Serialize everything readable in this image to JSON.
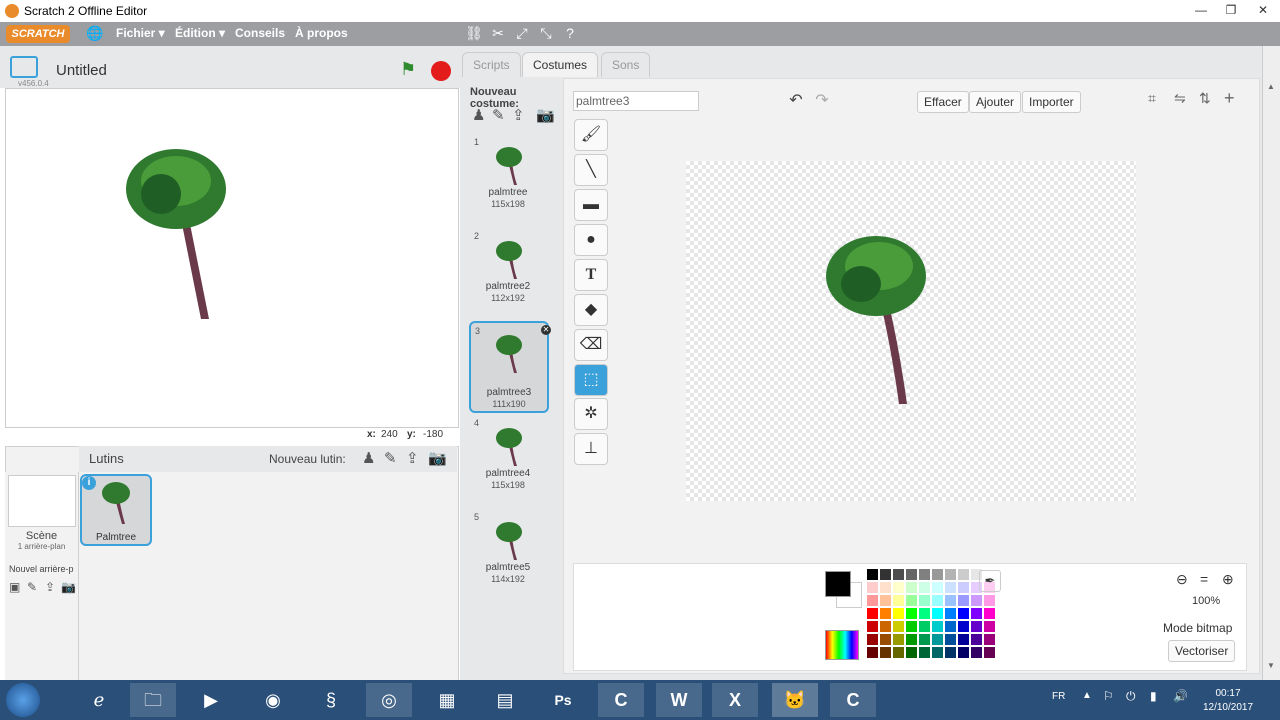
{
  "window": {
    "title": "Scratch 2 Offline Editor",
    "minimize": "—",
    "maximize": "❐",
    "close": "✕"
  },
  "menubar": {
    "logo": "SCRATCH",
    "items": [
      "Fichier ▾",
      "Édition ▾",
      "Conseils",
      "À propos"
    ]
  },
  "stage": {
    "project_title": "Untitled",
    "version": "v456.0.4",
    "x_label": "x:",
    "x_value": "240",
    "y_label": "y:",
    "y_value": "-180"
  },
  "sprites": {
    "header": "Lutins",
    "new_sprite_label": "Nouveau lutin:",
    "scene_label": "Scène",
    "scene_sub": "1 arrière-plan",
    "new_backdrop_label": "Nouvel arrière-p",
    "items": [
      {
        "name": "Palmtree",
        "selected": true
      }
    ]
  },
  "tabs": [
    "Scripts",
    "Costumes",
    "Sons"
  ],
  "active_tab": "Costumes",
  "costumes": {
    "new_label": "Nouveau costume:",
    "items": [
      {
        "num": "1",
        "name": "palmtree",
        "size": "115x198"
      },
      {
        "num": "2",
        "name": "palmtree2",
        "size": "112x192"
      },
      {
        "num": "3",
        "name": "palmtree3",
        "size": "111x190"
      },
      {
        "num": "4",
        "name": "palmtree4",
        "size": "115x198"
      },
      {
        "num": "5",
        "name": "palmtree5",
        "size": "114x192"
      }
    ],
    "selected_index": 2
  },
  "editor": {
    "costume_name": "palmtree3",
    "clear": "Effacer",
    "add": "Ajouter",
    "import": "Importer",
    "zoom": "100%",
    "mode_label": "Mode bitmap",
    "convert_button": "Vectoriser",
    "palette": [
      [
        "#000000",
        "#333333",
        "#4d4d4d",
        "#666666",
        "#808080",
        "#999999",
        "#b3b3b3",
        "#cccccc",
        "#e6e6e6",
        "#ffffff"
      ],
      [
        "#ffcccc",
        "#ffe0cc",
        "#ffffcc",
        "#ccffcc",
        "#ccffe6",
        "#ccffff",
        "#cce0ff",
        "#ccccff",
        "#e6ccff",
        "#ffccf2"
      ],
      [
        "#ff9999",
        "#ffc299",
        "#ffff99",
        "#99ff99",
        "#99ffcc",
        "#99ffff",
        "#99c2ff",
        "#9999ff",
        "#cc99ff",
        "#ff99e6"
      ],
      [
        "#ff0000",
        "#ff8000",
        "#ffff00",
        "#00ff00",
        "#00ff80",
        "#00ffff",
        "#0080ff",
        "#0000ff",
        "#8000ff",
        "#ff00cc"
      ],
      [
        "#cc0000",
        "#cc6600",
        "#cccc00",
        "#00cc00",
        "#00cc66",
        "#00cccc",
        "#0066cc",
        "#0000cc",
        "#6600cc",
        "#cc00a3"
      ],
      [
        "#990000",
        "#994d00",
        "#999900",
        "#009900",
        "#00994d",
        "#009999",
        "#004d99",
        "#000099",
        "#4d0099",
        "#99007a"
      ],
      [
        "#660000",
        "#663300",
        "#666600",
        "#006600",
        "#006633",
        "#006666",
        "#003366",
        "#000066",
        "#330066",
        "#660052"
      ]
    ]
  },
  "taskbar": {
    "lang": "FR",
    "time": "00:17",
    "date": "12/10/2017"
  }
}
